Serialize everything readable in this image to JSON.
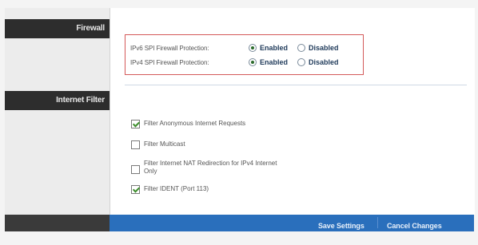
{
  "sidebar": {
    "firewall_label": "Firewall",
    "internet_filter_label": "Internet Filter"
  },
  "firewall": {
    "ipv6": {
      "label": "IPv6 SPI Firewall Protection:",
      "enabled_label": "Enabled",
      "disabled_label": "Disabled",
      "selected": "Enabled"
    },
    "ipv4": {
      "label": "IPv4 SPI Firewall Protection:",
      "enabled_label": "Enabled",
      "disabled_label": "Disabled",
      "selected": "Enabled"
    }
  },
  "filters": [
    {
      "label": "Filter Anonymous Internet Requests",
      "checked": true
    },
    {
      "label": "Filter Multicast",
      "checked": false
    },
    {
      "label_line1": "Filter Internet NAT Redirection for IPv4 Internet",
      "label_line2": "Only",
      "checked": false
    },
    {
      "label": "Filter IDENT (Port 113)",
      "checked": true
    }
  ],
  "footer": {
    "save_label": "Save Settings",
    "cancel_label": "Cancel Changes"
  },
  "colors": {
    "accent_blue": "#2a6fbc",
    "highlight_border": "#d45a5a",
    "sidebar_header": "#2d2d2d"
  }
}
